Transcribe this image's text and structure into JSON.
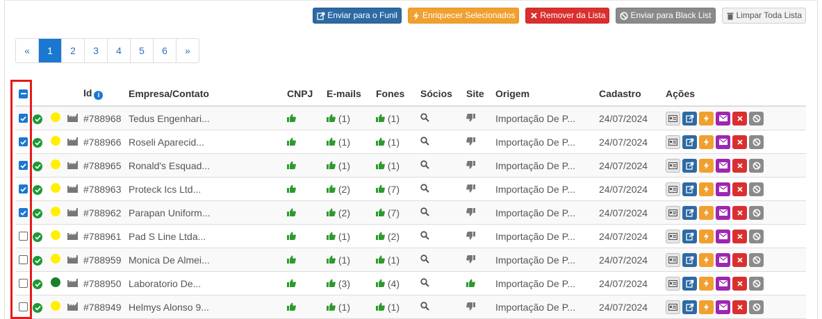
{
  "toolbar": {
    "send_funnel": "Enviar para o Funil",
    "enrich": "Enriquecer Selecionados",
    "remove": "Remover da Lista",
    "blacklist": "Enviar para Black List",
    "clear": "Limpar Toda Lista"
  },
  "pagination": {
    "prev": "«",
    "pages": [
      "1",
      "2",
      "3",
      "4",
      "5",
      "6"
    ],
    "next": "»",
    "current": "1"
  },
  "table": {
    "headers": {
      "id": "Id",
      "company": "Empresa/Contato",
      "cnpj": "CNPJ",
      "emails": "E-mails",
      "phones": "Fones",
      "partners": "Sócios",
      "site": "Site",
      "origin": "Origem",
      "created": "Cadastro",
      "actions": "Ações"
    },
    "rows": [
      {
        "checked": true,
        "dot": "yellow",
        "id": "#788968",
        "company": "Tedus Engenhari...",
        "emails": "(1)",
        "phones": "(1)",
        "site": "down",
        "origin": "Importação De P...",
        "date": "24/07/2024"
      },
      {
        "checked": true,
        "dot": "yellow",
        "id": "#788966",
        "company": "Roseli Aparecid...",
        "emails": "(1)",
        "phones": "(1)",
        "site": "down",
        "origin": "Importação De P...",
        "date": "24/07/2024"
      },
      {
        "checked": true,
        "dot": "yellow",
        "id": "#788965",
        "company": "Ronald's Esquad...",
        "emails": "(1)",
        "phones": "(1)",
        "site": "down",
        "origin": "Importação De P...",
        "date": "24/07/2024"
      },
      {
        "checked": true,
        "dot": "yellow",
        "id": "#788963",
        "company": "Proteck Ics Ltd...",
        "emails": "(2)",
        "phones": "(7)",
        "site": "down",
        "origin": "Importação De P...",
        "date": "24/07/2024"
      },
      {
        "checked": true,
        "dot": "yellow",
        "id": "#788962",
        "company": "Parapan Uniform...",
        "emails": "(2)",
        "phones": "(7)",
        "site": "down",
        "origin": "Importação De P...",
        "date": "24/07/2024"
      },
      {
        "checked": false,
        "dot": "yellow",
        "id": "#788961",
        "company": "Pad S Line Ltda...",
        "emails": "(1)",
        "phones": "(2)",
        "site": "down",
        "origin": "Importação De P...",
        "date": "24/07/2024"
      },
      {
        "checked": false,
        "dot": "yellow",
        "id": "#788959",
        "company": "Monica De Almei...",
        "emails": "(1)",
        "phones": "(1)",
        "site": "down",
        "origin": "Importação De P...",
        "date": "24/07/2024"
      },
      {
        "checked": false,
        "dot": "green",
        "id": "#788950",
        "company": "Laboratorio De...",
        "emails": "(3)",
        "phones": "(4)",
        "site": "up",
        "origin": "Importação De P...",
        "date": "24/07/2024"
      },
      {
        "checked": false,
        "dot": "yellow",
        "id": "#788949",
        "company": "Helmys Alonso 9...",
        "emails": "(1)",
        "phones": "(1)",
        "site": "down",
        "origin": "Importação De P...",
        "date": "24/07/2024"
      }
    ]
  },
  "colors": {
    "accent": "#1a78d1",
    "highlight_box": "#e41b1b"
  },
  "icons": {
    "status": "check-circle-icon",
    "building": "building-icon",
    "cnpj": "thumbs-up-icon",
    "partners": "search-icon",
    "site_down": "thumbs-down-icon",
    "site_up": "thumbs-up-icon"
  }
}
